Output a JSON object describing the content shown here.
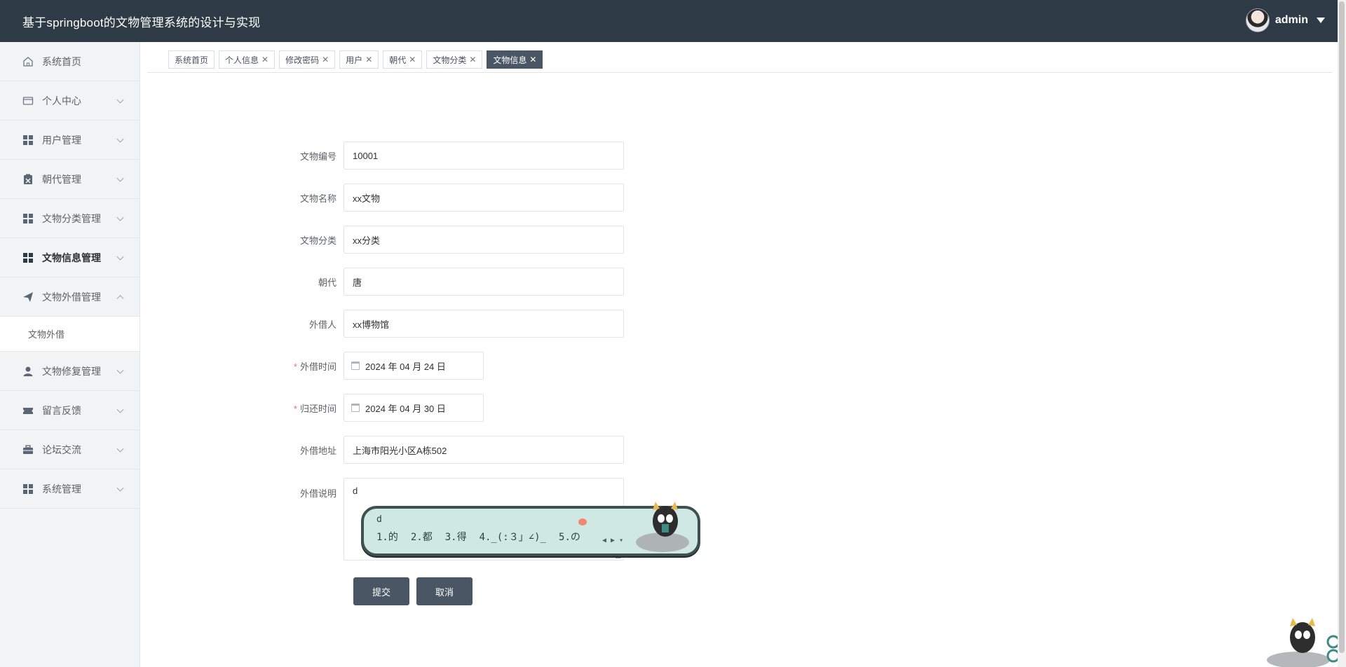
{
  "header": {
    "title": "基于springboot的文物管理系统的设计与实现",
    "username": "admin"
  },
  "sidebar": {
    "items": [
      {
        "label": "系统首页",
        "icon": "home-icon"
      },
      {
        "label": "个人中心",
        "icon": "id-card-icon"
      },
      {
        "label": "用户管理",
        "icon": "grid-icon"
      },
      {
        "label": "朝代管理",
        "icon": "clipboard-icon"
      },
      {
        "label": "文物分类管理",
        "icon": "grid-icon"
      },
      {
        "label": "文物信息管理",
        "icon": "grid-icon"
      },
      {
        "label": "文物外借管理",
        "icon": "send-icon"
      },
      {
        "label": "文物修复管理",
        "icon": "user-icon"
      },
      {
        "label": "留言反馈",
        "icon": "ticket-icon"
      },
      {
        "label": "论坛交流",
        "icon": "briefcase-icon"
      },
      {
        "label": "系统管理",
        "icon": "grid-icon"
      }
    ],
    "sub_item": "文物外借"
  },
  "tabs": [
    {
      "label": "系统首页"
    },
    {
      "label": "个人信息"
    },
    {
      "label": "修改密码"
    },
    {
      "label": "用户"
    },
    {
      "label": "朝代"
    },
    {
      "label": "文物分类"
    },
    {
      "label": "文物信息"
    }
  ],
  "form": {
    "fields": [
      {
        "label": "文物编号",
        "value": "10001"
      },
      {
        "label": "文物名称",
        "value": "xx文物"
      },
      {
        "label": "文物分类",
        "value": "xx分类"
      },
      {
        "label": "朝代",
        "value": "唐"
      },
      {
        "label": "外借人",
        "value": "xx博物馆"
      }
    ],
    "lend_time": {
      "label": "外借时间",
      "value": "2024 年 04 月 24 日"
    },
    "return_time": {
      "label": "归还时间",
      "value": "2024 年 04 月 30 日"
    },
    "address": {
      "label": "外借地址",
      "value": "上海市阳光小区A栋502"
    },
    "description": {
      "label": "外借说明",
      "value": "d"
    },
    "required_mark": "*",
    "submit": "提交",
    "cancel": "取消"
  },
  "ime": {
    "composing": "d",
    "candidates": [
      "1.的",
      "2.都",
      "3.得",
      "4._(:３」∠)_",
      "5.の"
    ]
  },
  "colors": {
    "header_bg": "#2f3a47",
    "button_bg": "#4a5663",
    "active_tab_bg": "#4a5663",
    "required": "#f56c6c"
  }
}
